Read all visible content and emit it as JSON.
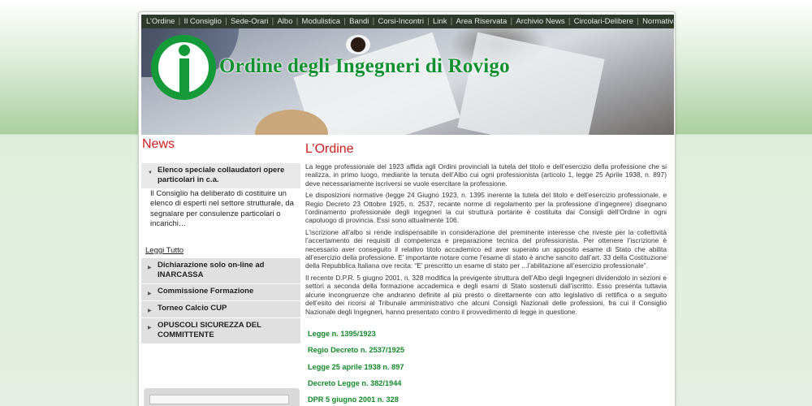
{
  "nav": {
    "items": [
      "L’Ordine",
      "Il Consiglio",
      "Sede-Orari",
      "Albo",
      "Modulistica",
      "Bandi",
      "Corsi-Incontri",
      "Link",
      "Area Riservata",
      "Archivio News",
      "Circolari-Delibere",
      "Normativa tecnica"
    ]
  },
  "header": {
    "site_title": "Ordine degli Ingegneri di Rovigo"
  },
  "sidebar": {
    "news_title": "News",
    "open_item": "Elenco speciale collaudatori opere particolari in c.a.",
    "open_item_body": "Il Consiglio ha deliberato  di costituire un elenco di esperti nel settore strutturale, da segnalare per consulenze particolari o incarichi…",
    "read_all": "Leggi Tutto",
    "items": [
      "Dichiarazione solo on-line ad INARCASSA",
      "Commissione Formazione",
      "Torneo Calcio CUP",
      "OPUSCOLI SICUREZZA DEL COMMITTENTE"
    ]
  },
  "main": {
    "title": "L’Ordine",
    "paragraphs": [
      "La legge professionale del 1923 affida agli Ordini provinciali la tutela del titolo e dell’esercizio della professione che si realizza, in primo luogo, mediante la tenuta dell’Albo cui ogni professionista (articolo 1, legge 25 Aprile 1938, n. 897) deve necessariamente iscriversi se vuole esercitare la professione.",
      "Le disposizioni normative (legge 24 Giugno 1923, n. 1395 inerente la tutela del titolo e dell’esercizio professionale, e Regio Decreto 23 Ottobre 1925, n. 2537, recante norme di regolamento per la professione d’ingegnere) disegnano l’ordinamento professionale degli ingegneri la cui struttura portante è costituita dai Consigli dell’Ordine in ogni capoluogo di provincia. Essi sono attualmente 106.",
      "L’iscrizione all’albo si rende indispensabile in considerazione del preminente interesse che riveste per la collettività l’accertamento dei requisiti di competenza e preparazione tecnica del professionista. Per ottenere l’iscrizione è necessario aver conseguito il relativo titolo accademico ed aver superato un apposito esame di Stato che abilita all’esercizio della professione. E’ importante notare come l’esame di stato è anche sancito dall’art. 33 della Costituzione della Repubblica Italiana ove recita: “E’ prescritto un esame di stato per ...l’abilitazione all’esercizio professionale”.",
      "Il recente D.P.R. 5 giugno 2001, n. 328 modifica la previgente struttura dell’Albo degli Ingegneri dividendolo in sezioni e settori a seconda della formazione accademica e degli esami di Stato sostenuti dall’iscritto. Esso presenta tuttavia alcune incongruenze che andranno definite al più presto o direttamente con atto legislativo di rettifica o a seguito dell’esito dei ricorsi al Tribunale amministrativo che alcuni Consigli Nazionali delle professioni, fra cui il Consiglio Nazionale degli Ingegneri, hanno presentato contro il provvedimento di legge in questione."
    ],
    "laws": [
      "Legge n. 1395/1923",
      "Regio Decreto n. 2537/1925",
      "Legge 25 aprile 1938 n. 897",
      "Decreto Legge n. 382/1944",
      "DPR 5 giugno 2001 n. 328"
    ]
  },
  "colors": {
    "accent_red": "#d01d1d",
    "brand_green": "#159a3a",
    "link_green": "#138a2a",
    "nav_bg": "#2f3a2c"
  }
}
